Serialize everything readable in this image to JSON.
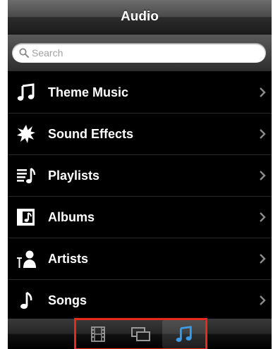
{
  "header": {
    "title": "Audio"
  },
  "search": {
    "placeholder": "Search",
    "value": ""
  },
  "list": {
    "items": [
      {
        "label": "Theme Music",
        "icon": "music-note-icon"
      },
      {
        "label": "Sound Effects",
        "icon": "burst-icon"
      },
      {
        "label": "Playlists",
        "icon": "playlist-icon"
      },
      {
        "label": "Albums",
        "icon": "album-icon"
      },
      {
        "label": "Artists",
        "icon": "artist-icon"
      },
      {
        "label": "Songs",
        "icon": "single-note-icon"
      }
    ]
  },
  "tabbar": {
    "tabs": [
      {
        "icon": "film-icon",
        "selected": false
      },
      {
        "icon": "windows-icon",
        "selected": false
      },
      {
        "icon": "music-note-icon",
        "selected": true
      }
    ],
    "highlight_color": "#e8291c",
    "selected_color": "#3d9ce8"
  }
}
